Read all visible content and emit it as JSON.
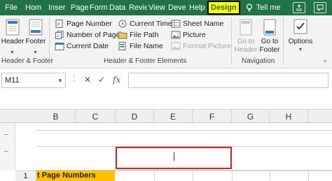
{
  "tabs": [
    "File",
    "Hom",
    "Inser",
    "Page",
    "Form",
    "Data",
    "Revie",
    "View",
    "Deve",
    "Help",
    "Design"
  ],
  "tell_me": "Tell me",
  "ribbon": {
    "header_btn": "Header",
    "footer_btn": "Footer",
    "group_hf": "Header & Footer",
    "page_number": "Page Number",
    "number_of_pages": "Number of Pages",
    "current_date": "Current Date",
    "current_time": "Current Time",
    "file_path": "File Path",
    "file_name": "File Name",
    "sheet_name": "Sheet Name",
    "picture": "Picture",
    "format_picture": "Format Picture",
    "group_elements": "Header & Footer Elements",
    "goto_header_1": "Go to",
    "goto_header_2": "Header",
    "goto_footer_1": "Go to",
    "goto_footer_2": "Footer",
    "group_navigation": "Navigation",
    "options": "Options"
  },
  "formula_bar": {
    "name_box": "M11",
    "fx": "fx",
    "cancel": "✕",
    "enter": "✓"
  },
  "columns": [
    "B",
    "C",
    "D",
    "E",
    "F",
    "G",
    "H"
  ],
  "rows": [
    {
      "number": "1",
      "title_cell": "t Page Numbers"
    }
  ],
  "colors": {
    "accent": "#217346",
    "highlight": "#ffff00",
    "selection_box": "#e01b1b",
    "cell_fill": "#ffc000"
  }
}
